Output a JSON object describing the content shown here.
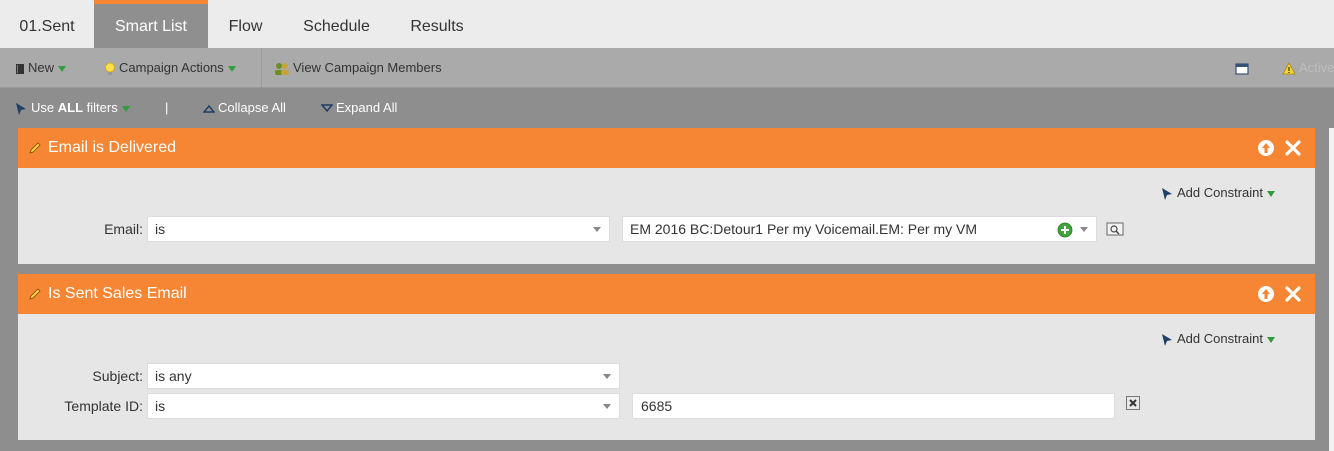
{
  "tabs": [
    {
      "label": "01.Sent"
    },
    {
      "label": "Smart List"
    },
    {
      "label": "Flow"
    },
    {
      "label": "Schedule"
    },
    {
      "label": "Results"
    }
  ],
  "toolbar": {
    "new_label": "New",
    "campaign_actions_label": "Campaign Actions",
    "view_members_label": "View Campaign Members",
    "status_label": "Active"
  },
  "filterbar": {
    "use_label": "Use",
    "all_label": "ALL",
    "filters_label": "filters",
    "separator": "|",
    "collapse_label": "Collapse All",
    "expand_label": "Expand All"
  },
  "filters": [
    {
      "title": "Email is Delivered",
      "add_constraint": "Add Constraint",
      "email_label": "Email:",
      "email_operator": "is",
      "email_value": "EM 2016 BC:Detour1 Per my Voicemail.EM: Per my VM"
    },
    {
      "title": "Is Sent Sales Email",
      "add_constraint": "Add Constraint",
      "subject_label": "Subject:",
      "subject_operator": "is any",
      "template_label": "Template ID:",
      "template_operator": "is",
      "template_value": "6685"
    }
  ],
  "colors": {
    "accent": "#f68634",
    "toolbar": "#aaaaaa",
    "filterbar": "#8e8e8e",
    "filter_body": "#e6e6e6"
  }
}
